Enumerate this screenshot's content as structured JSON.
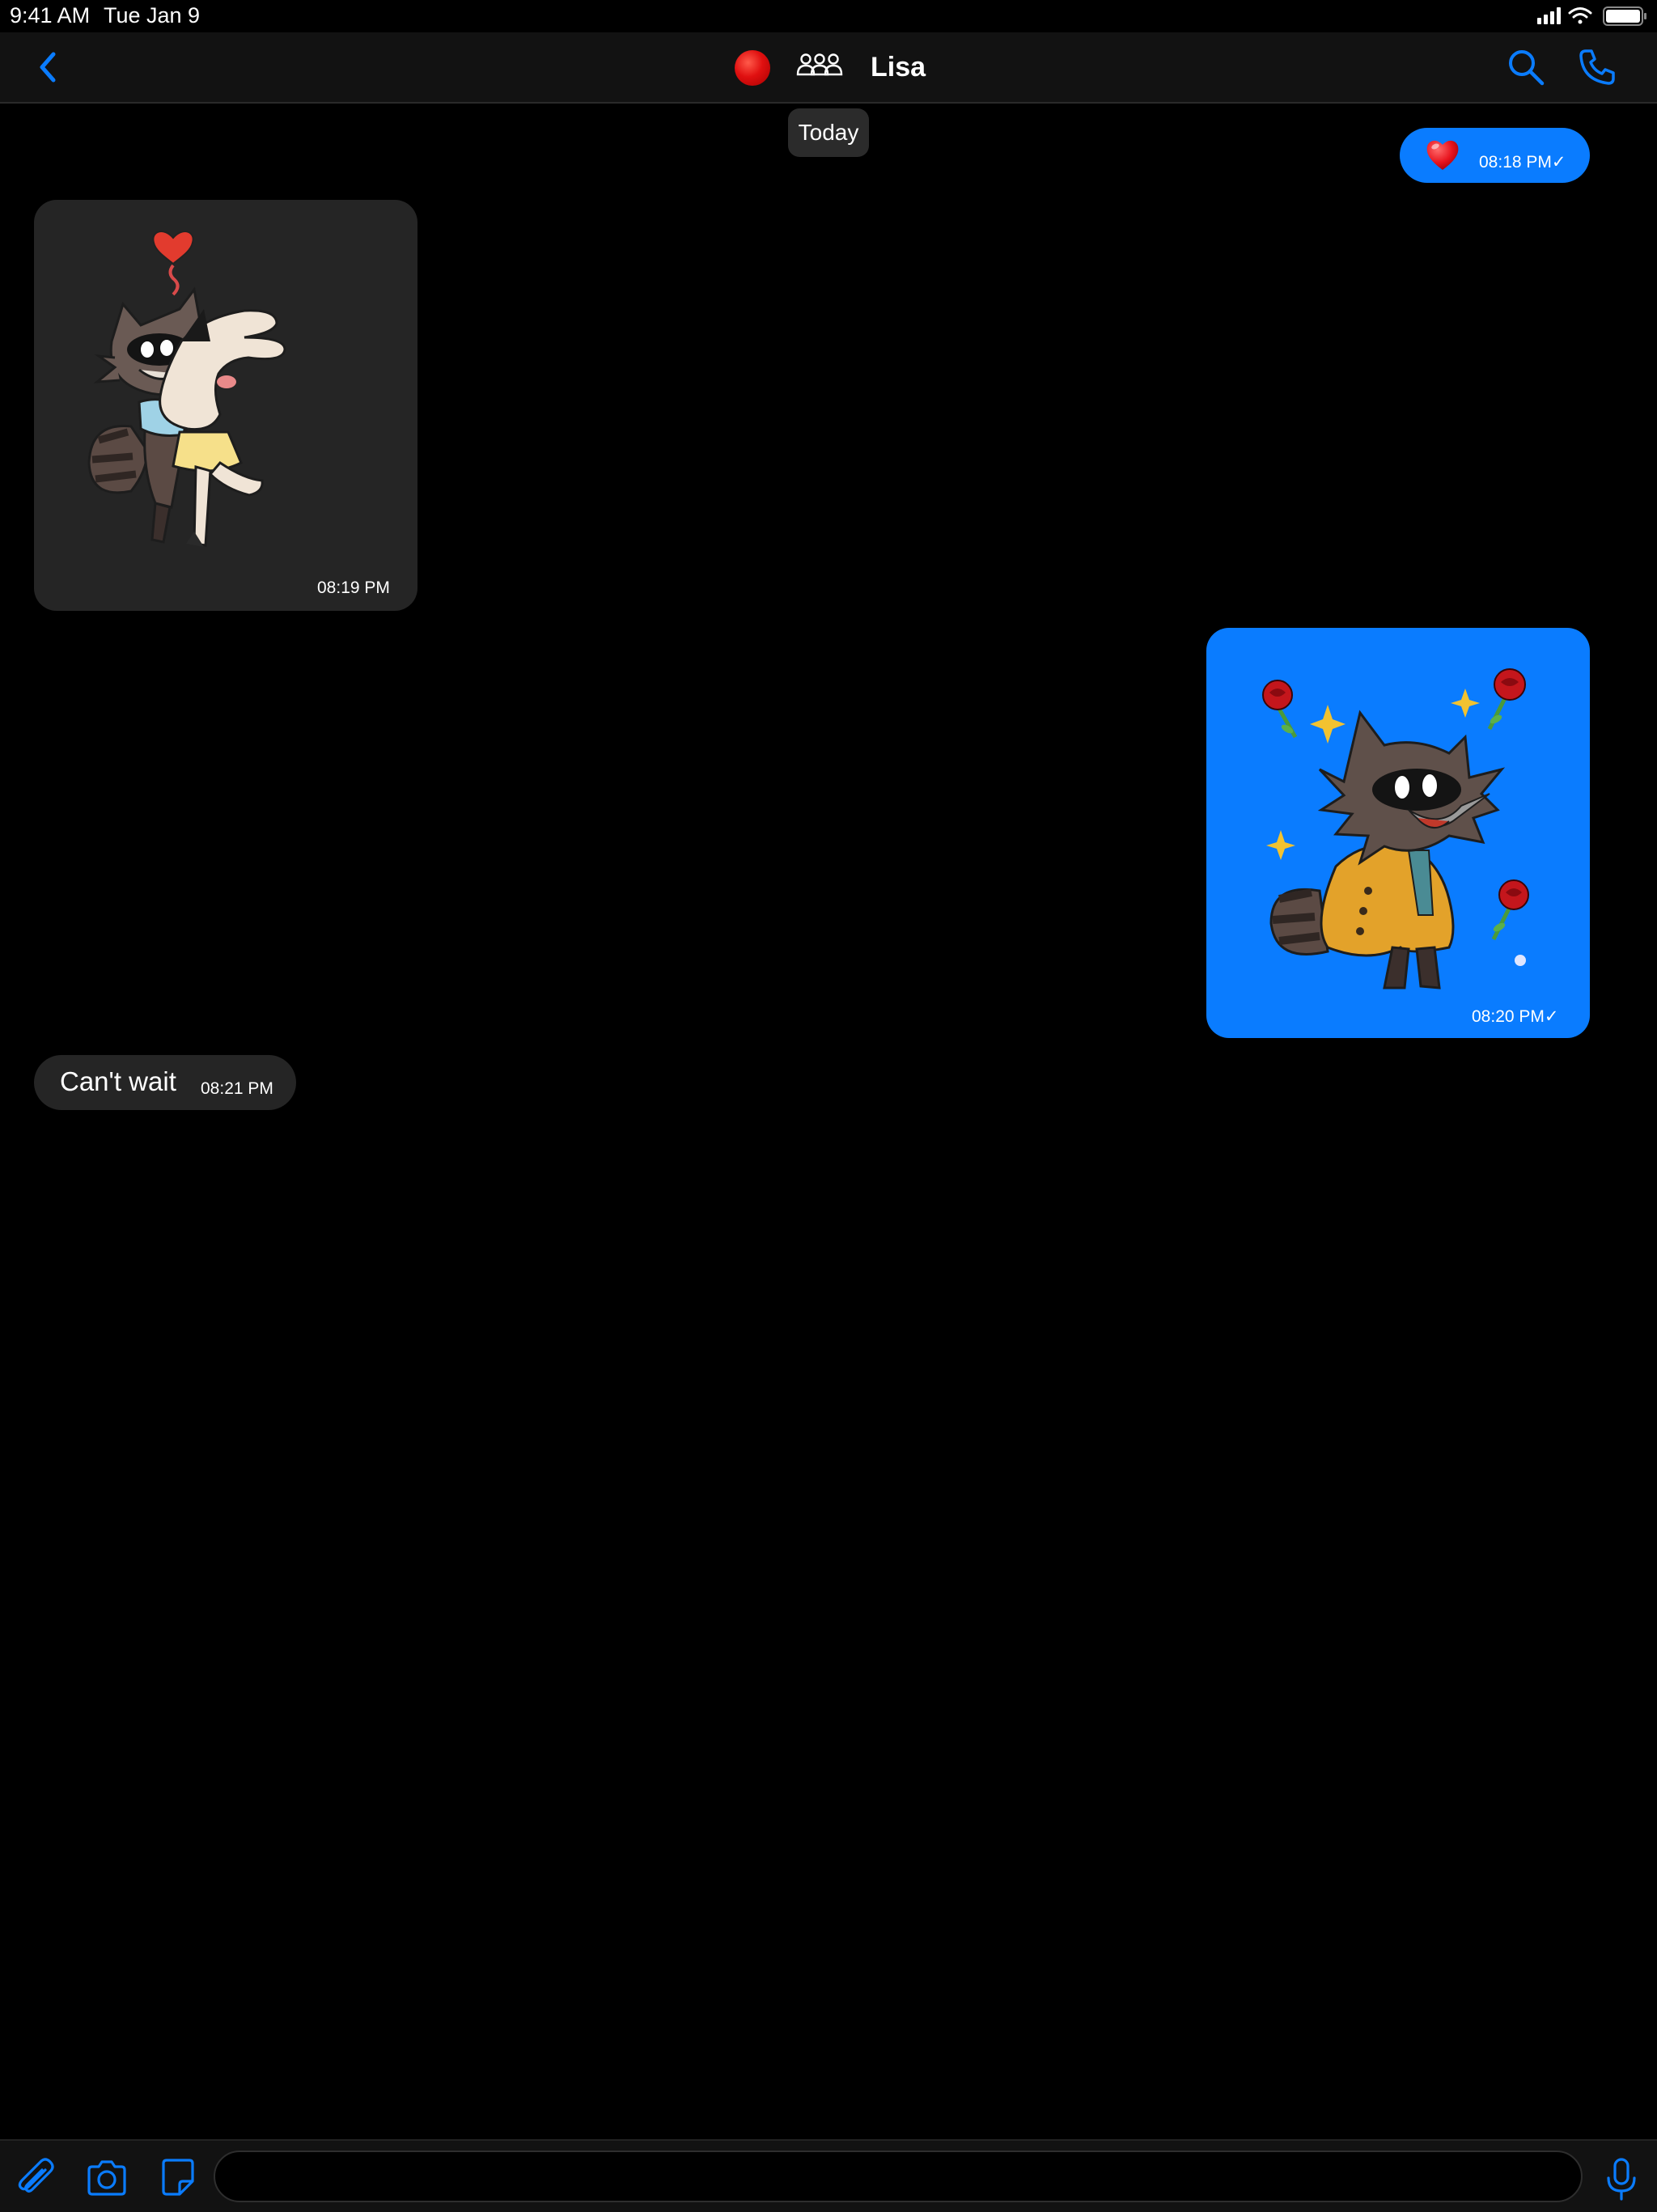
{
  "status_bar": {
    "time": "9:41 AM",
    "date": "Tue Jan 9"
  },
  "header": {
    "title": "Lisa",
    "icons": [
      "back-chevron-icon",
      "avatar",
      "group-icon",
      "search-icon",
      "phone-icon"
    ]
  },
  "colors": {
    "accent": "#0a7cff",
    "incoming_bubble": "#252525",
    "background": "#000000",
    "bar": "#121212"
  },
  "conversation": {
    "date_separator": "Today",
    "messages": [
      {
        "direction": "outgoing",
        "kind": "emoji",
        "content": "heart-emoji",
        "time": "08:18 PM✓"
      },
      {
        "direction": "incoming",
        "kind": "sticker",
        "content": "raccoon-bunny-hug-sticker",
        "time": "08:19 PM"
      },
      {
        "direction": "outgoing",
        "kind": "sticker",
        "content": "raccoon-roses-sticker",
        "time": "08:20 PM✓"
      },
      {
        "direction": "incoming",
        "kind": "text",
        "text": "Can't wait",
        "time": "08:21 PM"
      }
    ]
  },
  "composer": {
    "placeholder": "",
    "icons": [
      "attach-icon",
      "camera-icon",
      "sticker-icon",
      "microphone-icon"
    ]
  }
}
